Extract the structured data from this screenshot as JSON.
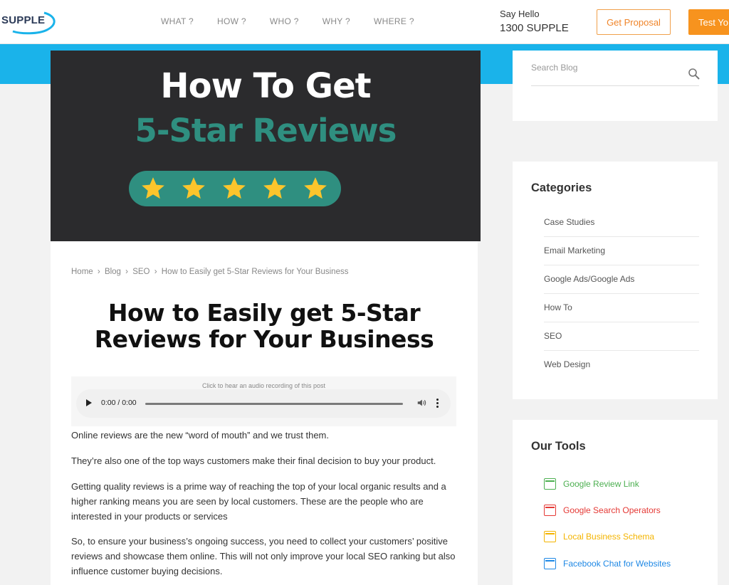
{
  "header": {
    "logo_text": "SUPPLE",
    "nav": [
      "WHAT ?",
      "HOW ?",
      "WHO ?",
      "WHY ?",
      "WHERE ?"
    ],
    "hello": "Say Hello",
    "phone": "1300 SUPPLE",
    "proposal_label": "Get Proposal",
    "test_label": "Test Yo"
  },
  "hero": {
    "line1": "How To Get",
    "line2": "5-Star Reviews",
    "star_count": 5
  },
  "breadcrumb": [
    "Home",
    "›",
    "Blog",
    "›",
    "SEO",
    "›",
    "How to Easily get 5-Star Reviews for Your Business"
  ],
  "article": {
    "title_line1": "How to Easily get 5-Star",
    "title_line2": "Reviews for Your Business",
    "audio_caption": "Click to hear an audio recording of this post",
    "audio_time": "0:00 / 0:00",
    "paragraphs": [
      "Online reviews are the new “word of mouth” and we trust them.",
      "They’re also one of the top ways customers make their final decision to buy your product.",
      "Getting quality reviews is a prime way of reaching the top of your local organic results and a higher ranking means you are seen by local customers. These are the people who are interested in your products or services",
      "So, to ensure your business’s ongoing success, you need to collect your customers’ positive reviews and showcase them online. This will not only improve your local SEO ranking but also influence customer buying decisions."
    ]
  },
  "sidebar": {
    "search_placeholder": "Search Blog",
    "categories_title": "Categories",
    "categories": [
      "Case Studies",
      "Email Marketing",
      "Google Ads/Google Ads",
      "How To",
      "SEO",
      "Web Design"
    ],
    "tools_title": "Our Tools",
    "tools": [
      {
        "label": "Google Review Link",
        "color": "#4caf50"
      },
      {
        "label": "Google Search Operators",
        "color": "#e53935"
      },
      {
        "label": "Local Business Schema",
        "color": "#f4b400"
      },
      {
        "label": "Facebook Chat for Websites",
        "color": "#1e88e5"
      }
    ]
  },
  "colors": {
    "accent_blue": "#1ab3ea",
    "accent_orange": "#f7931e",
    "hero_teal": "#2f8f80",
    "star_yellow": "#fcc52c"
  }
}
